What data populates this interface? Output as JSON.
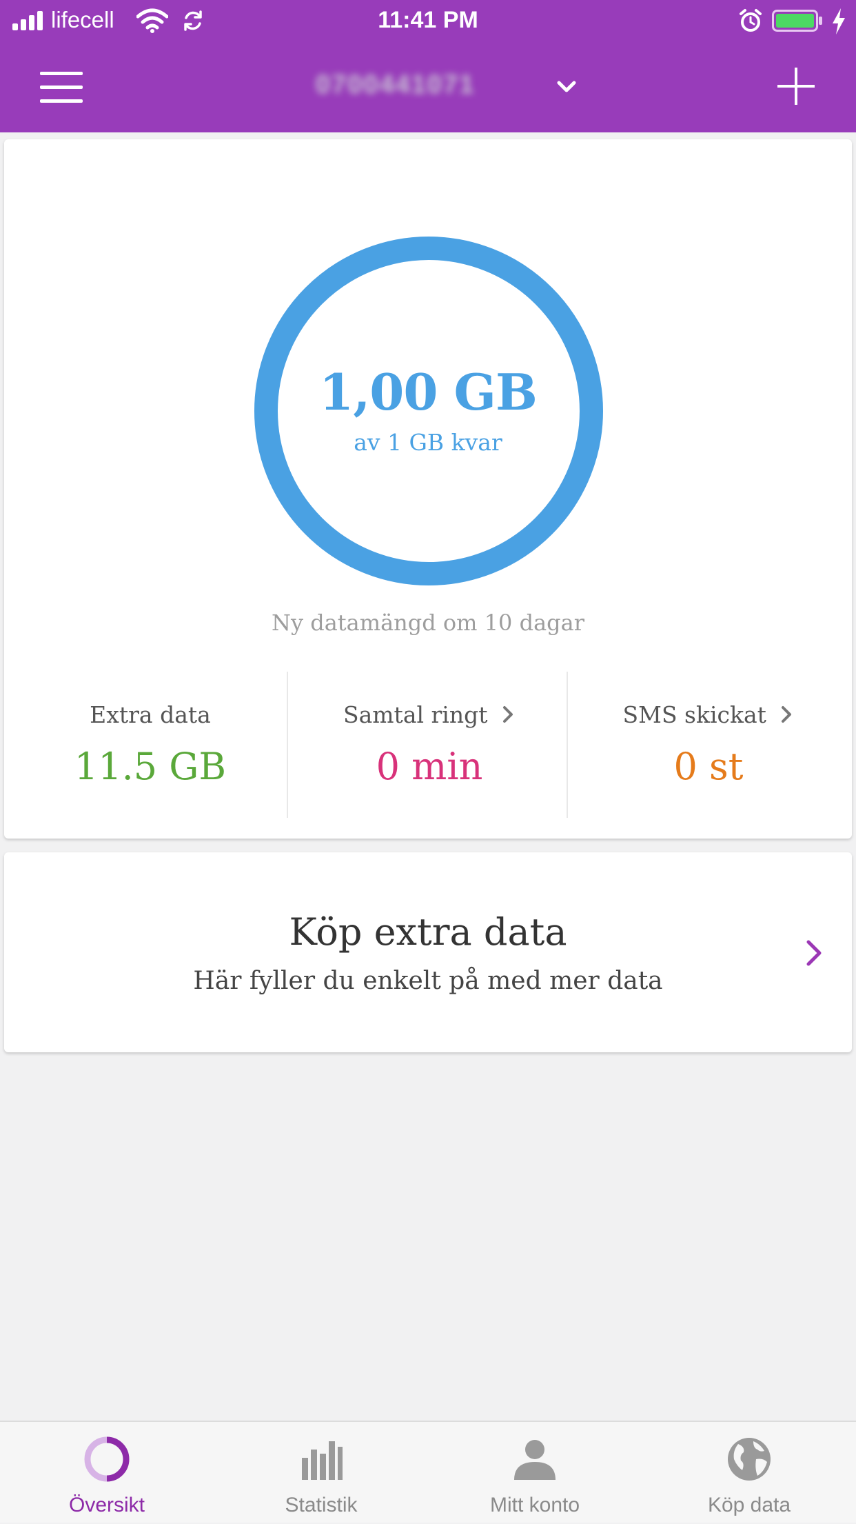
{
  "status_bar": {
    "carrier": "lifecell",
    "time": "11:41 PM"
  },
  "header": {
    "account_name": "0700441071",
    "background_color": "#983cba"
  },
  "overview": {
    "data_remaining": "1,00 GB",
    "data_caption": "av 1 GB kvar",
    "remaining_fraction": 1.0,
    "renewal_text": "Ny datamängd om 10 dagar",
    "ring_color": "#4aa1e3",
    "stats": [
      {
        "label": "Extra data",
        "value": "11.5 GB",
        "color": "#5aa83a",
        "has_arrow": false
      },
      {
        "label": "Samtal ringt",
        "value": "0 min",
        "color": "#d8327a",
        "has_arrow": true
      },
      {
        "label": "SMS skickat",
        "value": "0 st",
        "color": "#e57b1b",
        "has_arrow": true
      }
    ]
  },
  "buy_card": {
    "title": "Köp extra data",
    "subtitle": "Här fyller du enkelt på med mer data"
  },
  "tabs": [
    {
      "label": "Översikt",
      "icon": "overview-ring-icon",
      "active": true
    },
    {
      "label": "Statistik",
      "icon": "bar-chart-icon",
      "active": false
    },
    {
      "label": "Mitt konto",
      "icon": "person-icon",
      "active": false
    },
    {
      "label": "Köp data",
      "icon": "globe-icon",
      "active": false
    }
  ]
}
